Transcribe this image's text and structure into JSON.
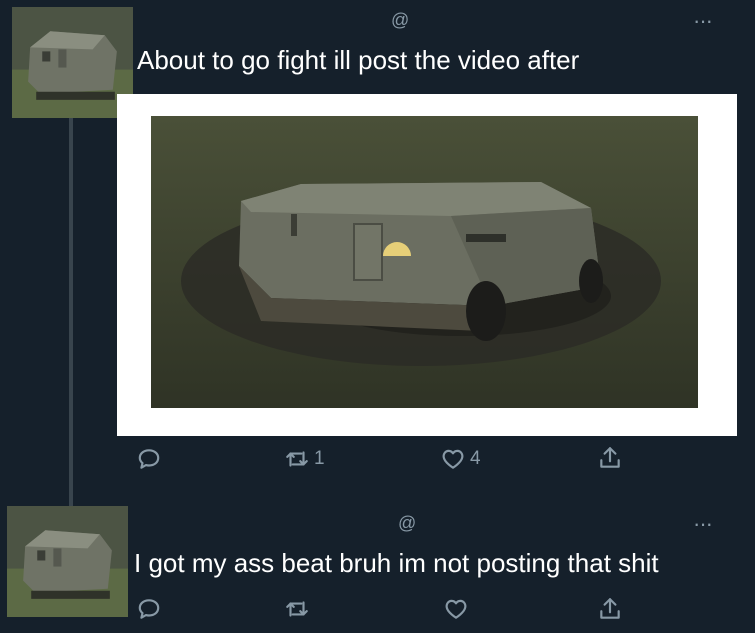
{
  "tweets": [
    {
      "handle": "@",
      "more": "···",
      "text": "About to go fight ill post the video after",
      "actions": {
        "reply_count": "",
        "retweet_count": "1",
        "like_count": "4"
      }
    },
    {
      "handle": "@",
      "more": "···",
      "text": "I got my ass beat bruh im not posting that shit",
      "actions": {
        "reply_count": "",
        "retweet_count": "",
        "like_count": ""
      }
    }
  ],
  "icons": [
    "reply-icon",
    "retweet-icon",
    "like-icon",
    "share-icon",
    "more-icon"
  ],
  "colors": {
    "background": "#15202b",
    "muted": "#8899a6",
    "text": "#ffffff",
    "thread_line": "#38444d"
  }
}
